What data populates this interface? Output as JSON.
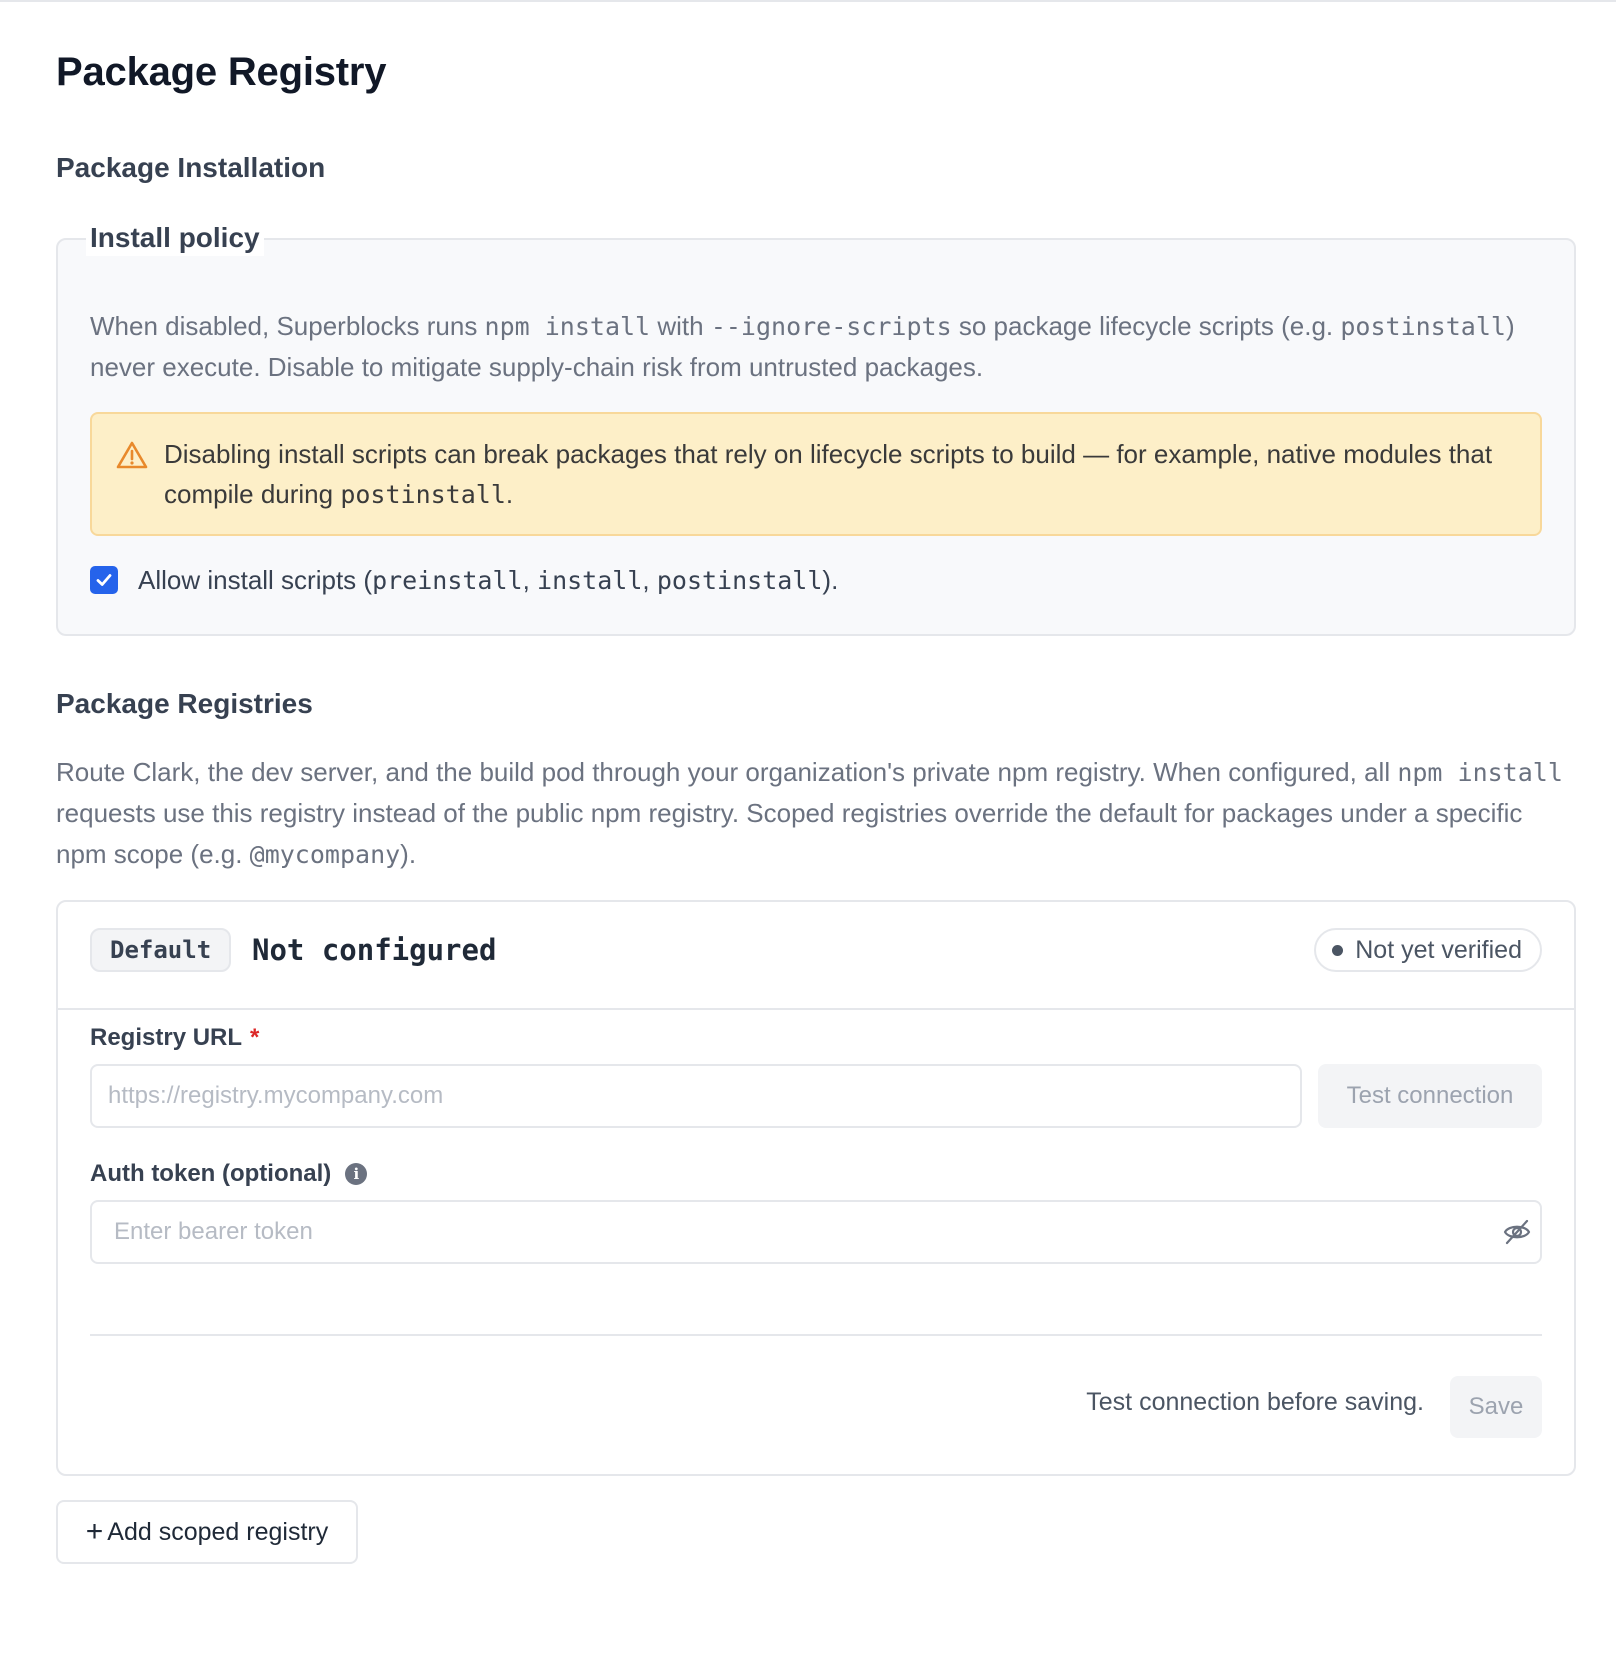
{
  "page": {
    "title": "Package Registry"
  },
  "install_section": {
    "heading": "Package Installation",
    "policy": {
      "legend": "Install policy",
      "desc_1": "When disabled, Superblocks runs ",
      "desc_code_1": "npm install",
      "desc_2": " with ",
      "desc_code_2": "--ignore-scripts",
      "desc_3": " so package lifecycle scripts (e.g. ",
      "desc_code_3": "postinstall",
      "desc_4": ") never execute. Disable to mitigate supply-chain risk from untrusted packages.",
      "warning_1": "Disabling install scripts can break packages that rely on lifecycle scripts to build — for example, native modules that compile during ",
      "warning_code": "postinstall",
      "warning_2": ".",
      "warning_icon": "warning-triangle-icon",
      "checkbox_checked": true,
      "checkbox_1": "Allow install scripts (",
      "checkbox_code_1": "preinstall",
      "checkbox_sep_1": ", ",
      "checkbox_code_2": "install",
      "checkbox_sep_2": ", ",
      "checkbox_code_3": "postinstall",
      "checkbox_2": ")."
    }
  },
  "registries_section": {
    "heading": "Package Registries",
    "desc_1": "Route Clark, the dev server, and the build pod through your organization's private npm registry. When configured, all ",
    "desc_code_1": "npm install",
    "desc_2": " requests use this registry instead of the public npm registry. Scoped registries override the default for packages under a specific npm scope (e.g. ",
    "desc_code_2": "@mycompany",
    "desc_3": ").",
    "card": {
      "badge": "Default",
      "title": "Not configured",
      "status": "Not yet verified",
      "url_label": "Registry URL",
      "url_required": "*",
      "url_value": "",
      "url_placeholder": "https://registry.mycompany.com",
      "test_button": "Test connection",
      "token_label": "Auth token (optional)",
      "token_info_icon": "info-icon",
      "token_value": "",
      "token_placeholder": "Enter bearer token",
      "token_toggle_icon": "eye-off-icon",
      "footer_note": "Test connection before saving.",
      "save_button": "Save"
    },
    "add_button": "Add scoped registry",
    "add_icon": "plus-icon"
  },
  "colors": {
    "accent": "#2563eb",
    "warning_bg": "#fdefc8",
    "warning_border": "#f8d89a",
    "warning_icon": "#e8892b",
    "required": "#dc2626"
  }
}
